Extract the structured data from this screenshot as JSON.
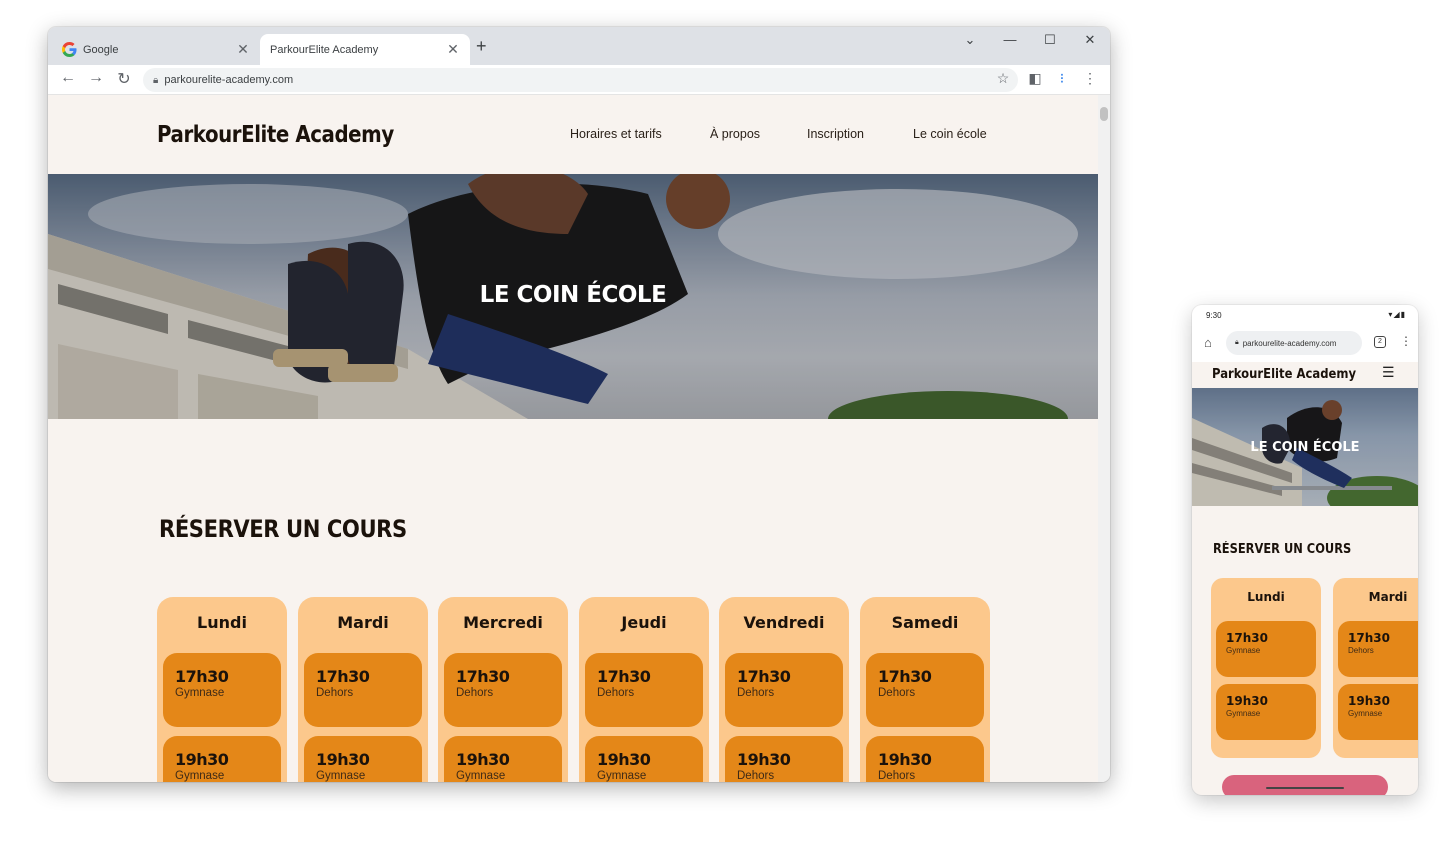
{
  "browser": {
    "tabs": [
      {
        "title": "Google",
        "active": false
      },
      {
        "title": "ParkourElite Academy",
        "active": true
      }
    ],
    "new_tab": "+",
    "url": "parkourelite-academy.com",
    "window_controls": [
      "⌄",
      "—",
      "☐",
      "✕"
    ]
  },
  "site": {
    "logo": "ParkourElite Academy",
    "nav": [
      "Horaires et tarifs",
      "À propos",
      "Inscription",
      "Le coin école"
    ],
    "hero_title": "LE COIN ÉCOLE",
    "section_title": "RÉSERVER UN COURS",
    "days": [
      {
        "name": "Lundi",
        "slots": [
          {
            "time": "17h30",
            "place": "Gymnase"
          },
          {
            "time": "19h30",
            "place": "Gymnase"
          }
        ]
      },
      {
        "name": "Mardi",
        "slots": [
          {
            "time": "17h30",
            "place": "Dehors"
          },
          {
            "time": "19h30",
            "place": "Gymnase"
          }
        ]
      },
      {
        "name": "Mercredi",
        "slots": [
          {
            "time": "17h30",
            "place": "Dehors"
          },
          {
            "time": "19h30",
            "place": "Gymnase"
          }
        ]
      },
      {
        "name": "Jeudi",
        "slots": [
          {
            "time": "17h30",
            "place": "Dehors"
          },
          {
            "time": "19h30",
            "place": "Gymnase"
          }
        ]
      },
      {
        "name": "Vendredi",
        "slots": [
          {
            "time": "17h30",
            "place": "Dehors"
          },
          {
            "time": "19h30",
            "place": "Dehors"
          }
        ]
      },
      {
        "name": "Samedi",
        "slots": [
          {
            "time": "17h30",
            "place": "Dehors"
          },
          {
            "time": "19h30",
            "place": "Dehors"
          }
        ]
      }
    ]
  },
  "phone": {
    "status_time": "9:30",
    "url": "parkourelite-academy.com",
    "tab_count": "2",
    "logo": "ParkourElite Academy",
    "hero_title": "LE COIN ÉCOLE",
    "section_title": "RÉSERVER UN COURS",
    "days": [
      {
        "name": "Lundi",
        "slots": [
          {
            "time": "17h30",
            "place": "Gymnase"
          },
          {
            "time": "19h30",
            "place": "Gymnase"
          }
        ]
      },
      {
        "name": "Mardi",
        "slots": [
          {
            "time": "17h30",
            "place": "Dehors"
          },
          {
            "time": "19h30",
            "place": "Gymnase"
          }
        ]
      }
    ]
  },
  "colors": {
    "page_bg": "#f8f3ef",
    "day_card": "#fcc88c",
    "slot_card": "#e48718",
    "text_dark": "#1b120b",
    "accent_pink": "#d9637d"
  }
}
